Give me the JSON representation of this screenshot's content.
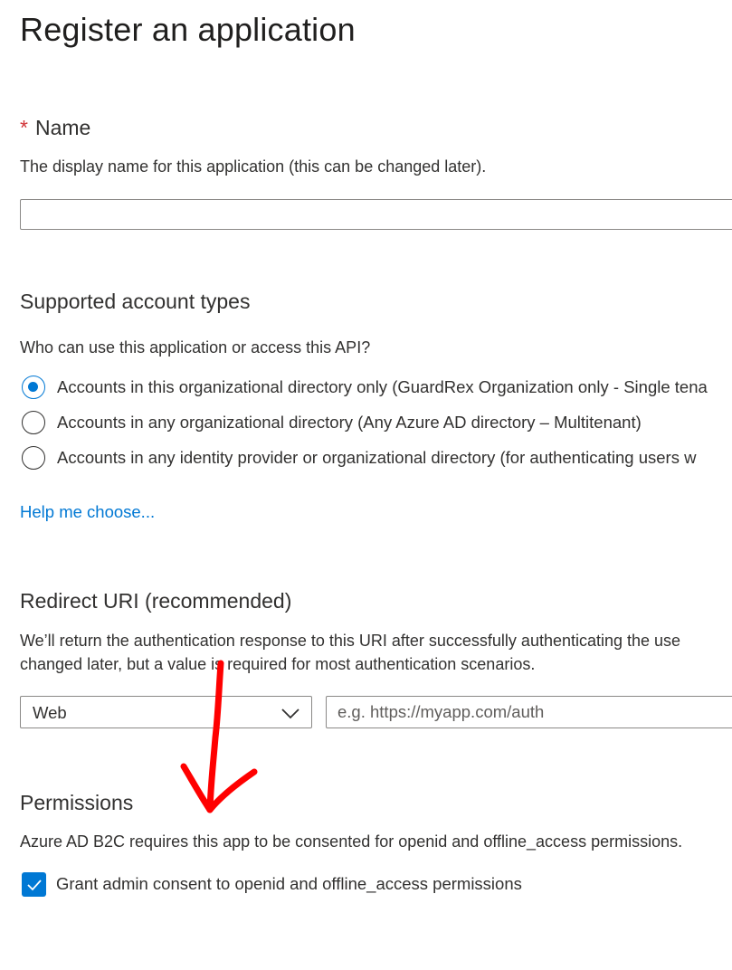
{
  "page": {
    "title": "Register an application"
  },
  "name_section": {
    "required_mark": "*",
    "label": "Name",
    "description": "The display name for this application (this can be changed later).",
    "input_value": ""
  },
  "account_types": {
    "title": "Supported account types",
    "question": "Who can use this application or access this API?",
    "options": [
      {
        "label": "Accounts in this organizational directory only (GuardRex Organization only - Single tena",
        "selected": true
      },
      {
        "label": "Accounts in any organizational directory (Any Azure AD directory – Multitenant)",
        "selected": false
      },
      {
        "label": "Accounts in any identity provider or organizational directory (for authenticating users w",
        "selected": false
      }
    ],
    "help_link": "Help me choose..."
  },
  "redirect": {
    "title": "Redirect URI (recommended)",
    "description_line1": "We’ll return the authentication response to this URI after successfully authenticating the use",
    "description_line2": "changed later, but a value is required for most authentication scenarios.",
    "platform_value": "Web",
    "uri_placeholder": "e.g. https://myapp.com/auth",
    "uri_value": ""
  },
  "permissions": {
    "title": "Permissions",
    "description": "Azure AD B2C requires this app to be consented for openid and offline_access permissions.",
    "checkbox_label": "Grant admin consent to openid and offline_access permissions",
    "checkbox_checked": true
  },
  "icons": {
    "select_chevron": "chevron-down-icon",
    "checkbox_check": "checkmark-icon",
    "annotation": "red-arrow-annotation"
  },
  "colors": {
    "accent": "#0078d4",
    "required": "#d13438",
    "text": "#323130",
    "border": "#8a8886",
    "annotation": "#ff0000"
  }
}
